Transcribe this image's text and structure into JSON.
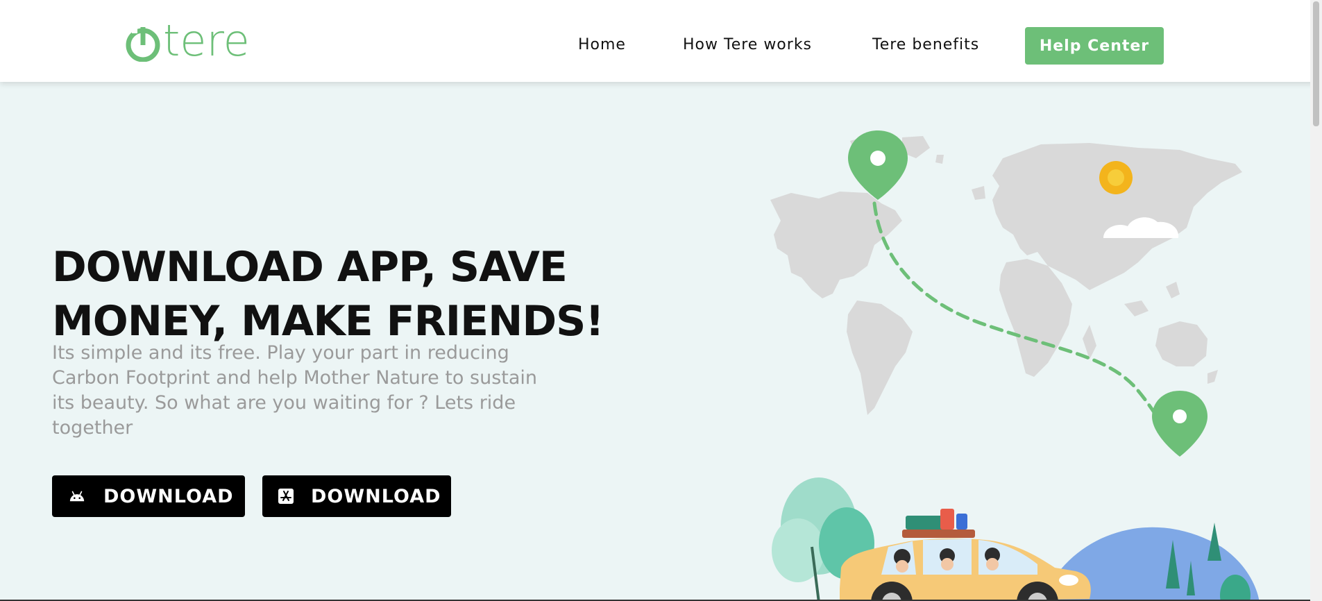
{
  "brand": {
    "name": "tere",
    "color": "#6dbf78"
  },
  "nav": {
    "items": [
      {
        "label": "Home"
      },
      {
        "label": "How Tere works"
      },
      {
        "label": "Tere benefits"
      }
    ],
    "cta_label": "Help Center"
  },
  "hero": {
    "headline_line1": "DOWNLOAD APP, SAVE",
    "headline_line2": "MONEY, MAKE FRIENDS!",
    "subtext": "Its simple and its free. Play your part in reducing Carbon Footprint and help Mother Nature to sustain its beauty. So what are you waiting for ? Lets ride together",
    "downloads": [
      {
        "label": "DOWNLOAD",
        "icon": "android-icon"
      },
      {
        "label": "DOWNLOAD",
        "icon": "app-store-icon"
      }
    ]
  },
  "colors": {
    "accent": "#6dbf78",
    "hero_background": "#ecf5f5",
    "text_dark": "#111111",
    "text_muted": "#9a9a9a"
  }
}
